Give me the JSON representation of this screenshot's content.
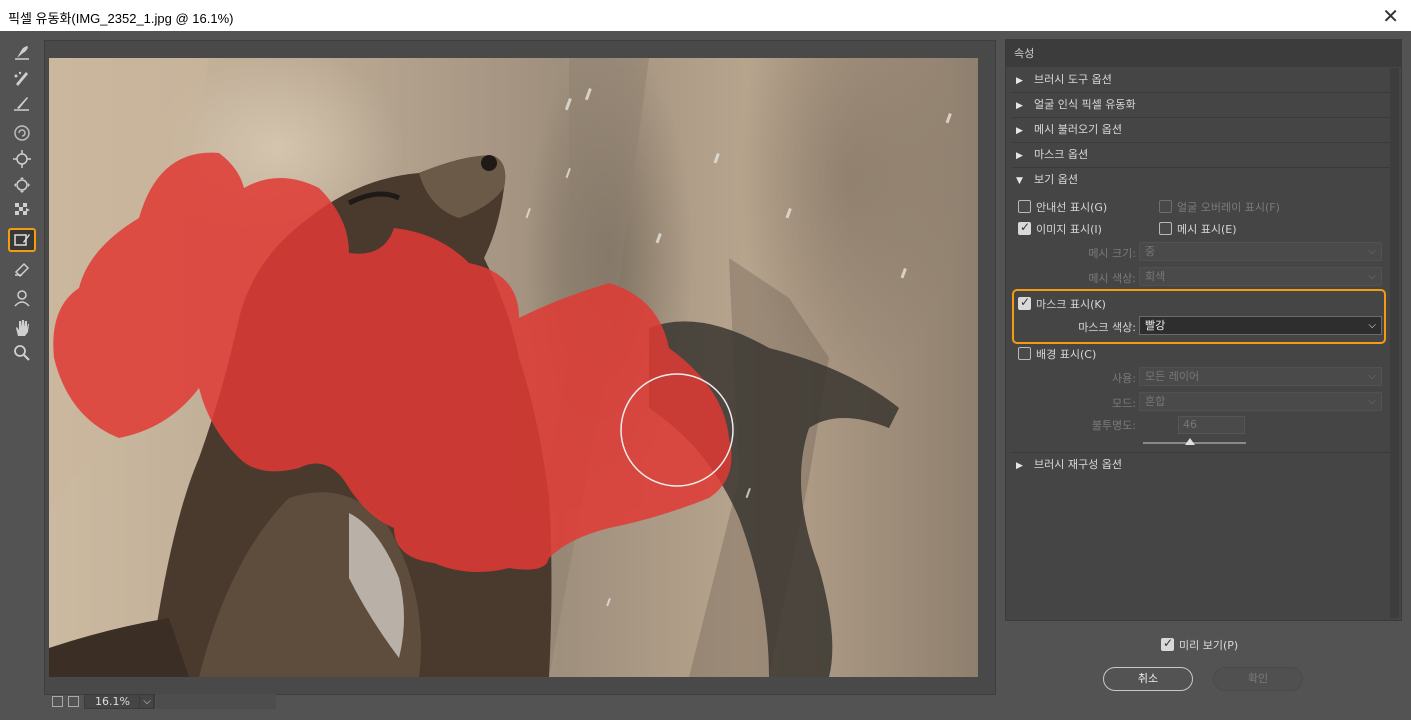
{
  "window": {
    "title": "픽셀 유동화(IMG_2352_1.jpg @ 16.1%)",
    "close": "✕"
  },
  "toolbar": {
    "tools": [
      "forward-warp",
      "reconstruct",
      "smooth",
      "twirl-clockwise",
      "pucker",
      "bloat",
      "push-left",
      "freeze-mask",
      "thaw-mask",
      "face-tool",
      "hand",
      "zoom"
    ],
    "active_tool": "freeze-mask",
    "highlight_color": "#f39c12"
  },
  "canvas": {
    "zoom": "16.1%",
    "mask_color": "#e03a34"
  },
  "props": {
    "title": "속성",
    "sections": {
      "brush_tool": "브러시 도구 옵션",
      "face_aware": "얼굴 인식 픽셀 유동화",
      "load_mesh": "메시 불러오기 옵션",
      "mask": "마스크 옵션",
      "view": "보기 옵션",
      "brush_reconstruct": "브러시 재구성 옵션"
    },
    "view": {
      "show_guides": "안내선 표시(G)",
      "show_face_overlay": "얼굴 오버레이 표시(F)",
      "show_image": "이미지 표시(I)",
      "show_mesh": "메시 표시(E)",
      "mesh_size_label": "메시 크기:",
      "mesh_size_value": "중",
      "mesh_color_label": "메시 색상:",
      "mesh_color_value": "회색",
      "show_mask": "마스크 표시(K)",
      "mask_color_label": "마스크 색상:",
      "mask_color_value": "빨강",
      "show_backdrop": "배경 표시(C)",
      "use_label": "사용:",
      "use_value": "모든 레이어",
      "mode_label": "모드:",
      "mode_value": "혼합",
      "opacity_label": "불투명도:",
      "opacity_value": "46",
      "opacity_fraction": 0.46
    }
  },
  "footer": {
    "preview": "미리 보기(P)",
    "cancel": "취소",
    "ok": "확인"
  }
}
